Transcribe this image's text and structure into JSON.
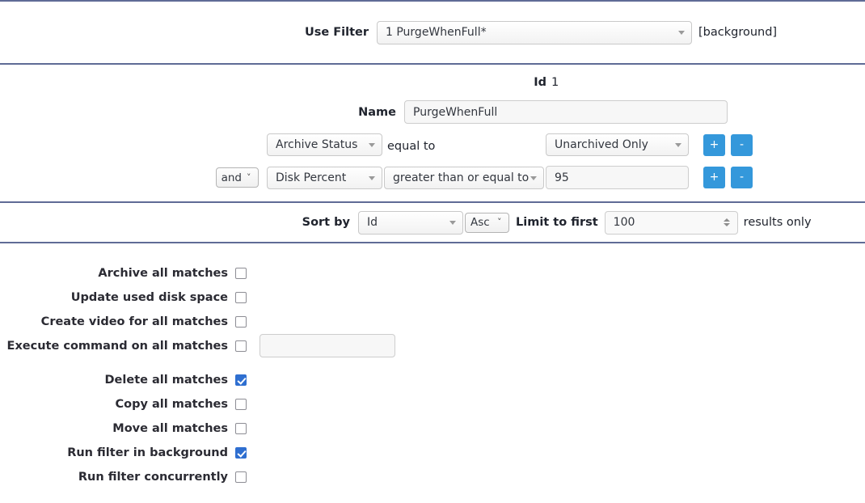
{
  "colors": {
    "accent_button": "#3498db",
    "checkbox_checked": "#2f6fd0",
    "divider": "#5f6b96"
  },
  "filter_bar": {
    "label": "Use Filter",
    "selected_filter": "1 PurgeWhenFull*",
    "background_note": "[background]"
  },
  "form": {
    "id_label": "Id",
    "id_value": "1",
    "name_label": "Name",
    "name_value": "PurgeWhenFull",
    "conditions": [
      {
        "conjunction": null,
        "field": "Archive Status",
        "operator": "equal to",
        "operator_is_select": false,
        "value": "Unarchived Only",
        "value_is_select": true,
        "add_label": "+",
        "remove_label": "-"
      },
      {
        "conjunction": "and",
        "field": "Disk Percent",
        "operator": "greater than or equal to",
        "operator_is_select": true,
        "value": "95",
        "value_is_select": false,
        "add_label": "+",
        "remove_label": "-"
      }
    ]
  },
  "sort": {
    "sort_by_label": "Sort by",
    "sort_field": "Id",
    "sort_direction": "Asc",
    "limit_label": "Limit to first",
    "limit_value": "100",
    "results_suffix": "results only"
  },
  "actions": [
    {
      "label": "Archive all matches",
      "checked": false,
      "has_input": false
    },
    {
      "label": "Update used disk space",
      "checked": false,
      "has_input": false
    },
    {
      "label": "Create video for all matches",
      "checked": false,
      "has_input": false
    },
    {
      "label": "Execute command on all matches",
      "checked": false,
      "has_input": true,
      "input_value": ""
    },
    {
      "label": "Delete all matches",
      "checked": true,
      "has_input": false
    },
    {
      "label": "Copy all matches",
      "checked": false,
      "has_input": false
    },
    {
      "label": "Move all matches",
      "checked": false,
      "has_input": false
    },
    {
      "label": "Run filter in background",
      "checked": true,
      "has_input": false
    },
    {
      "label": "Run filter concurrently",
      "checked": false,
      "has_input": false
    }
  ]
}
